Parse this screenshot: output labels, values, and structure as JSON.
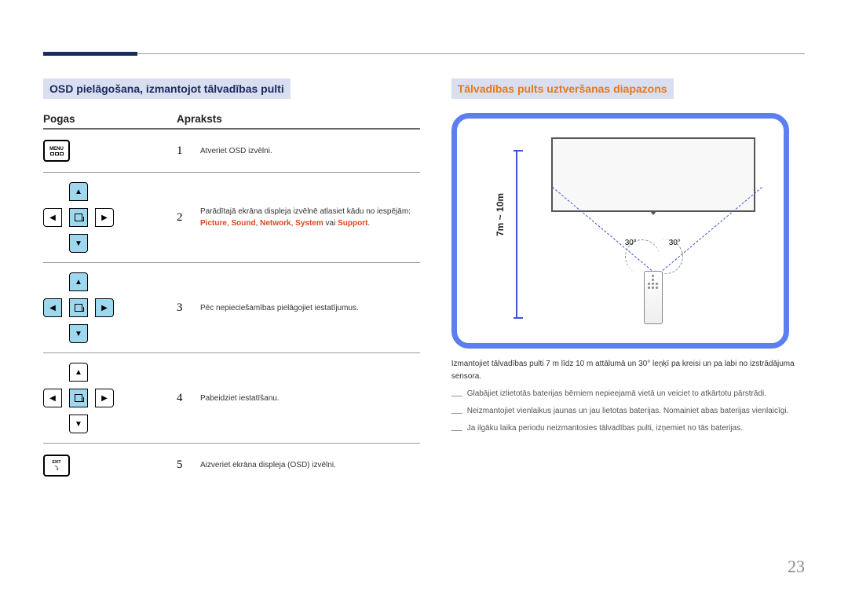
{
  "left": {
    "title": "OSD pielāgošana, izmantojot tālvadības pulti",
    "headers": {
      "buttons": "Pogas",
      "desc": "Apraksts"
    },
    "rows": [
      {
        "num": "1",
        "icon": "menu",
        "desc": "Atveriet OSD izvēlni."
      },
      {
        "num": "2",
        "icon": "dpad-ud-active",
        "desc_pre": "Parādītajā ekrāna displeja izvēlnē atlasiet kādu no iespējām: ",
        "options": [
          "Picture",
          "Sound",
          "Network",
          "System"
        ],
        "desc_mid": " vai ",
        "option_last": "Support",
        "desc_post": "."
      },
      {
        "num": "3",
        "icon": "dpad-all-active",
        "desc": "Pēc nepieciešamības pielāgojiet iestatījumus."
      },
      {
        "num": "4",
        "icon": "dpad-none-active",
        "desc": "Pabeidziet iestatīšanu."
      },
      {
        "num": "5",
        "icon": "exit",
        "desc": "Aizveriet ekrāna displeja (OSD) izvēlni."
      }
    ]
  },
  "right": {
    "title": "Tālvadības pults uztveršanas diapazons",
    "distance": "7m ~ 10m",
    "angle_left": "30°",
    "angle_right": "30°",
    "body": "Izmantojiet tālvadības pulti 7 m līdz 10 m attālumā un 30° leņķī pa kreisi un pa labi no izstrādājuma sensora.",
    "notes": [
      "Glabājiet izlietotās baterijas bērniem nepieejamā vietā un veiciet to atkārtotu pārstrādi.",
      "Neizmantojiet vienlaikus jaunas un jau lietotas baterijas. Nomainiet abas baterijas vienlaicīgi.",
      "Ja ilgāku laika periodu neizmantosies tālvadības pulti, izņemiet no tās baterijas."
    ]
  },
  "page": "23"
}
